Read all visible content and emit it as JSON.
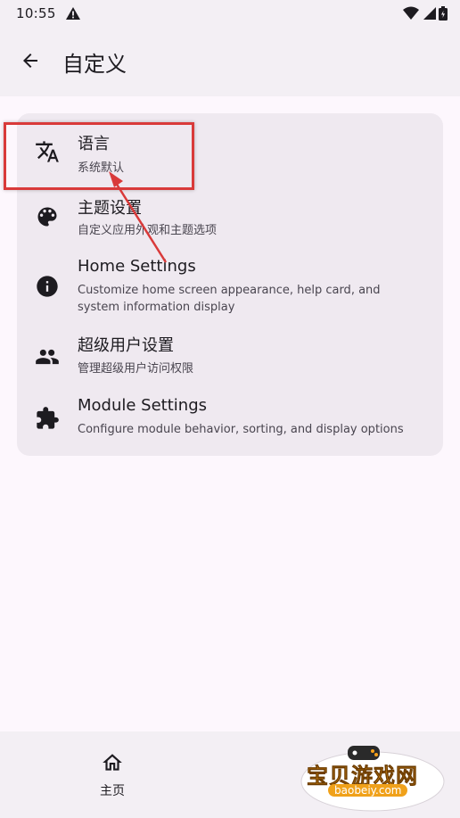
{
  "status": {
    "time": "10:55"
  },
  "topbar": {
    "title": "自定义"
  },
  "items": [
    {
      "title": "语言",
      "desc": "系统默认",
      "icon": "translate-icon"
    },
    {
      "title": "主题设置",
      "desc": "自定义应用外观和主题选项",
      "icon": "palette-icon"
    },
    {
      "title": "Home Settings",
      "desc": "Customize home screen appearance, help card, and system information display",
      "icon": "info-icon"
    },
    {
      "title": "超级用户设置",
      "desc": "管理超级用户访问权限",
      "icon": "people-icon"
    },
    {
      "title": "Module Settings",
      "desc": "Configure module behavior, sorting, and display options",
      "icon": "puzzle-icon"
    }
  ],
  "nav": {
    "home_label": "主页"
  },
  "watermark": {
    "text": "宝贝游戏网",
    "url": "baobeiy.com"
  },
  "colors": {
    "background": "#fdf7fd",
    "surface": "#f3eff4",
    "card": "#efe9f0",
    "highlight": "#d93a3a"
  }
}
